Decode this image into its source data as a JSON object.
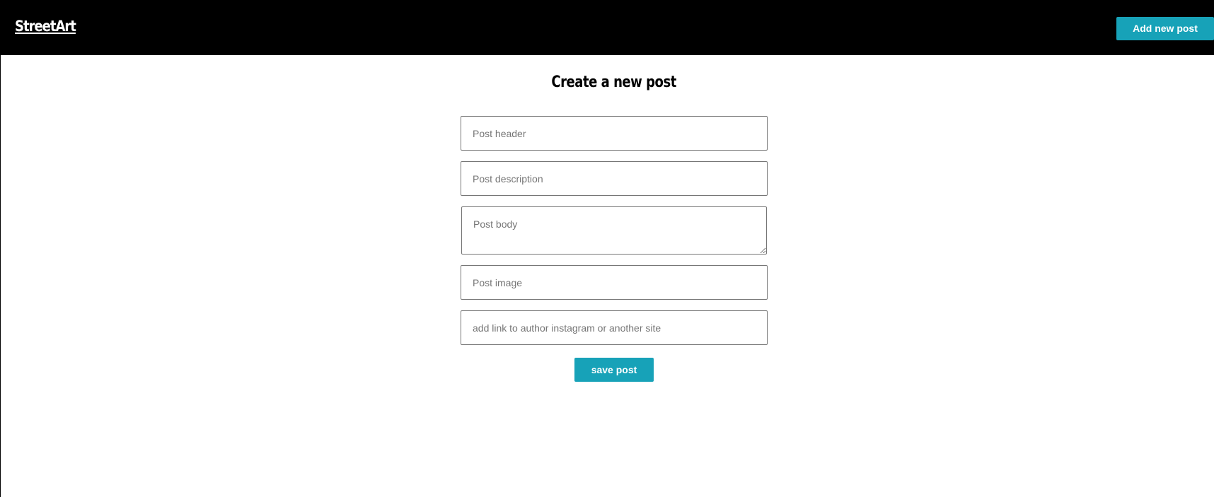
{
  "header": {
    "brand": "StreetArt",
    "add_post_label": "Add new post"
  },
  "main": {
    "title": "Create a new post",
    "form": {
      "post_header_placeholder": "Post header",
      "post_description_placeholder": "Post description",
      "post_body_placeholder": "Post body",
      "post_image_placeholder": "Post image",
      "author_link_placeholder": "add link to author instagram or another site",
      "submit_label": "save post"
    }
  },
  "colors": {
    "navbar_background": "#000000",
    "accent": "#17a2b8",
    "page_background": "#ffffff"
  }
}
